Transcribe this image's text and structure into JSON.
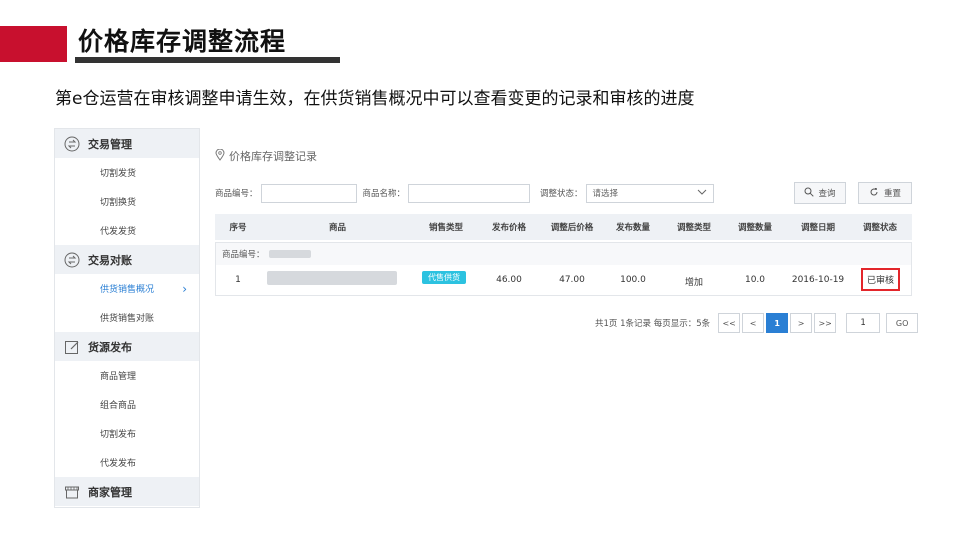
{
  "slide": {
    "title": "价格库存调整流程",
    "subtitle": "第e仓运营在审核调整申请生效，在供货销售概况中可以查看变更的记录和审核的进度",
    "accent_color": "#c8102e"
  },
  "sidebar": {
    "sections": [
      {
        "label": "交易管理",
        "icon": "exchange-icon",
        "items": [
          "切割发货",
          "切割换货",
          "代发发货"
        ]
      },
      {
        "label": "交易对账",
        "icon": "exchange-icon",
        "items": [
          "供货销售概况",
          "供货销售对账"
        ],
        "active": "供货销售概况"
      },
      {
        "label": "货源发布",
        "icon": "edit-icon",
        "items": [
          "商品管理",
          "组合商品",
          "切割发布",
          "代发发布"
        ]
      },
      {
        "label": "商家管理",
        "icon": "store-icon",
        "items": []
      }
    ]
  },
  "panel": {
    "title": "价格库存调整记录",
    "filters": {
      "product_code_label": "商品编号：",
      "product_name_label": "商品名称：",
      "status_label": "调整状态：",
      "status_selected": "请选择"
    },
    "buttons": {
      "search": "查询",
      "reset": "重置"
    },
    "table": {
      "headers": [
        "序号",
        "商品",
        "销售类型",
        "发布价格",
        "调整后价格",
        "发布数量",
        "调整类型",
        "调整数量",
        "调整日期",
        "调整状态"
      ],
      "group_label": "商品编号：",
      "rows": [
        {
          "index": "1",
          "sale_type": "代售供货",
          "publish_price": "46.00",
          "adjusted_price": "47.00",
          "publish_qty": "100.0",
          "adjust_type": "增加",
          "adjust_qty": "10.0",
          "date": "2016-10-19",
          "status": "已审核"
        }
      ]
    },
    "pager": {
      "summary": "共1页 1条记录 每页显示：5条",
      "first": "<<",
      "prev": "<",
      "current": "1",
      "next": ">",
      "last": ">>",
      "goto_value": "1",
      "go": "GO"
    }
  }
}
